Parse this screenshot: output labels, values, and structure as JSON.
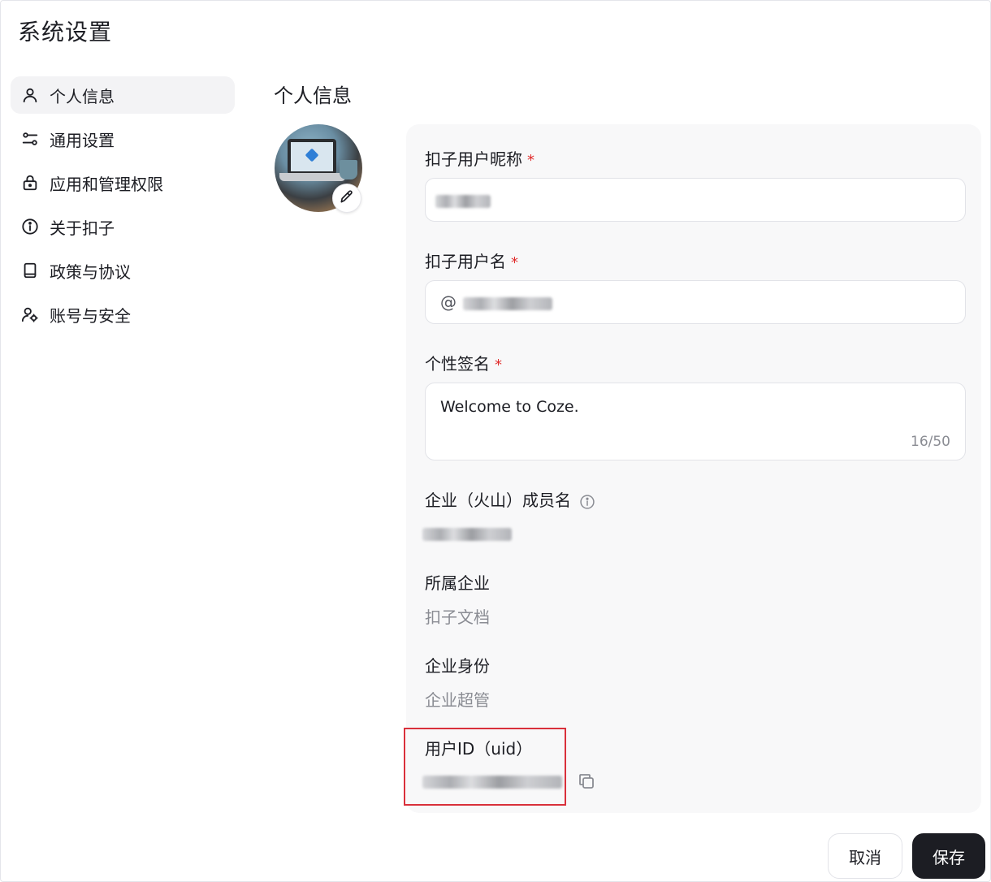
{
  "page": {
    "title": "系统设置"
  },
  "sidebar": {
    "items": [
      {
        "label": "个人信息",
        "icon": "user-icon",
        "active": true
      },
      {
        "label": "通用设置",
        "icon": "sliders-icon",
        "active": false
      },
      {
        "label": "应用和管理权限",
        "icon": "lock-icon",
        "active": false
      },
      {
        "label": "关于扣子",
        "icon": "info-icon",
        "active": false
      },
      {
        "label": "政策与协议",
        "icon": "book-icon",
        "active": false
      },
      {
        "label": "账号与安全",
        "icon": "user-settings-icon",
        "active": false
      }
    ]
  },
  "profile": {
    "section_title": "个人信息",
    "nickname": {
      "label": "扣子用户昵称",
      "required_mark": "*"
    },
    "username": {
      "label": "扣子用户名",
      "required_mark": "*",
      "prefix": "@"
    },
    "signature": {
      "label": "个性签名",
      "required_mark": "*",
      "value": "Welcome to Coze.",
      "counter": "16/50"
    },
    "member_name": {
      "label": "企业（火山）成员名"
    },
    "enterprise": {
      "label": "所属企业",
      "value": "扣子文档"
    },
    "identity": {
      "label": "企业身份",
      "value": "企业超管"
    },
    "uid": {
      "label": "用户ID（uid）"
    }
  },
  "footer": {
    "cancel_label": "取消",
    "save_label": "保存"
  },
  "colors": {
    "accent_dark": "#1c1d23",
    "required": "#e02b2b",
    "highlight": "#d9303b",
    "panel_bg": "#f8f8f9"
  }
}
